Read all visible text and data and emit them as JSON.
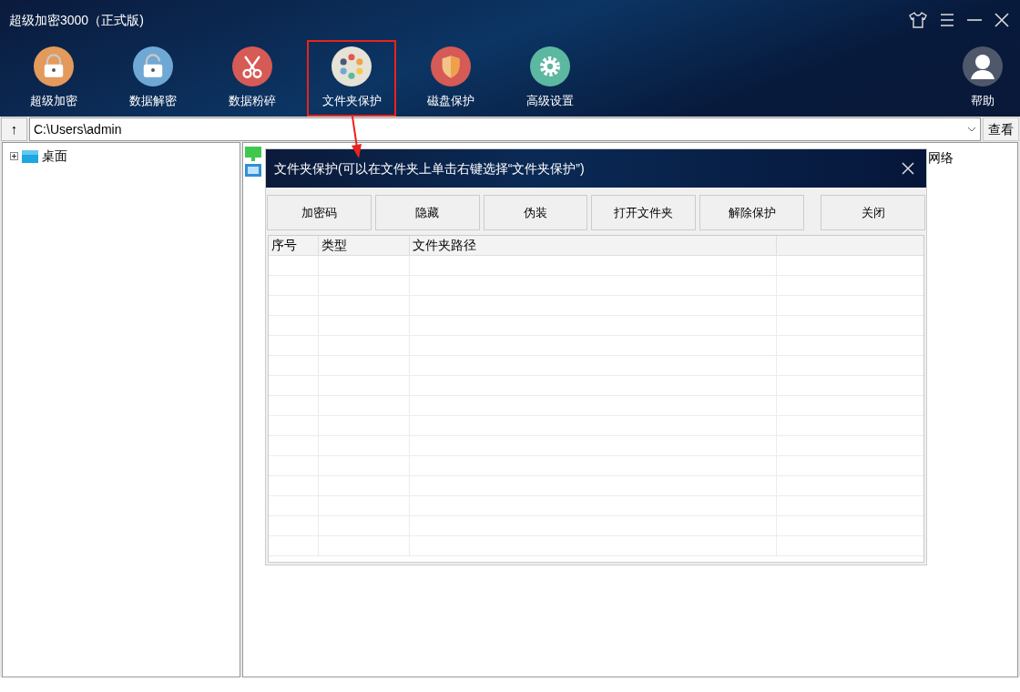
{
  "window": {
    "title": "超级加密3000（正式版)"
  },
  "toolbar": [
    {
      "label": "超级加密",
      "kind": "lock",
      "color": "#e39a5b",
      "highlighted": false
    },
    {
      "label": "数据解密",
      "kind": "unlock",
      "color": "#6fa8d4",
      "highlighted": false
    },
    {
      "label": "数据粉碎",
      "kind": "scissors",
      "color": "#d65a55",
      "highlighted": false
    },
    {
      "label": "文件夹保护",
      "kind": "palette",
      "color": "#e6e2d6",
      "highlighted": true
    },
    {
      "label": "磁盘保护",
      "kind": "shield",
      "color": "#d65a55",
      "highlighted": false
    },
    {
      "label": "高级设置",
      "kind": "gear",
      "color": "#5cb8a0",
      "highlighted": false
    }
  ],
  "help": {
    "label": "帮助"
  },
  "path_bar": {
    "up": "↑",
    "value": "C:\\Users\\admin",
    "view_button": "查看"
  },
  "tree": [
    {
      "label": "桌面",
      "expanded": false
    }
  ],
  "file_list": [
    {
      "label": "网络"
    }
  ],
  "dialog": {
    "title": "文件夹保护(可以在文件夹上单击右键选择“文件夹保护”)",
    "buttons": [
      "加密码",
      "隐藏",
      "伪装",
      "打开文件夹",
      "解除保护",
      "关闭"
    ],
    "columns": [
      "序号",
      "类型",
      "文件夹路径"
    ]
  }
}
